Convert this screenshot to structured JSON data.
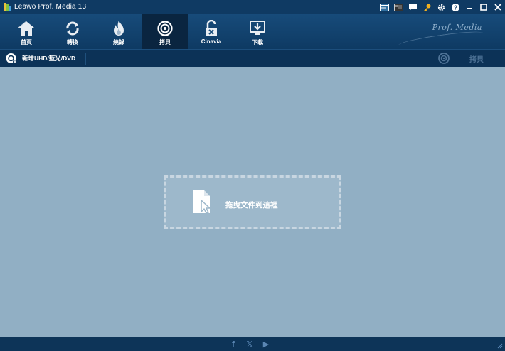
{
  "window": {
    "title": "Leawo Prof. Media 13"
  },
  "titlebar_icons": [
    {
      "name": "register-icon"
    },
    {
      "name": "media-icon"
    },
    {
      "name": "chat-icon"
    },
    {
      "name": "key-icon"
    },
    {
      "name": "settings-icon"
    },
    {
      "name": "help-icon"
    },
    {
      "name": "minimize-icon"
    },
    {
      "name": "maximize-icon"
    },
    {
      "name": "close-icon"
    }
  ],
  "nav": {
    "items": [
      {
        "label": "首頁",
        "icon": "home-icon"
      },
      {
        "label": "轉換",
        "icon": "convert-icon"
      },
      {
        "label": "燒錄",
        "icon": "burn-icon"
      },
      {
        "label": "拷貝",
        "icon": "copy-disc-icon",
        "active": true
      },
      {
        "label": "Cinavia",
        "icon": "unlock-icon"
      },
      {
        "label": "下載",
        "icon": "download-icon"
      }
    ],
    "brand": "Prof. Media"
  },
  "subbar": {
    "add_disc_label": "新增UHD/藍光/DVD",
    "copy_label": "拷貝"
  },
  "dropzone": {
    "text": "拖曳文件到這裡"
  },
  "footer": {
    "facebook": "f",
    "twitter": "𝕏",
    "youtube": "▶"
  },
  "colors": {
    "titlebar": "#0f3a63",
    "navbar": "#174b7a",
    "active_tab": "#0a2540",
    "main_bg": "#91afc4",
    "dropzone_border": "#c8d6e1",
    "key_icon": "#f2b01e"
  }
}
